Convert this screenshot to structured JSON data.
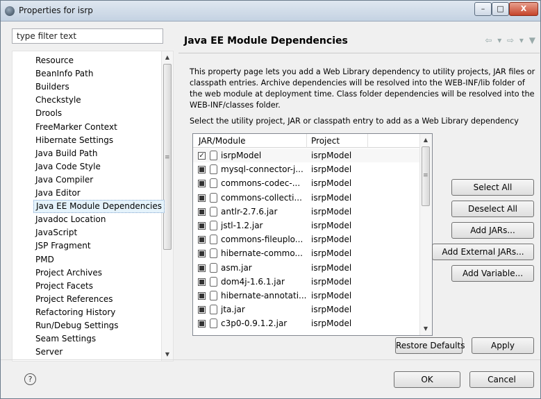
{
  "window": {
    "title": "Properties for isrp",
    "minimize_glyph": "–",
    "maximize_glyph": "□",
    "close_glyph": "X"
  },
  "filter": {
    "placeholder": "type filter text",
    "value": "type filter text"
  },
  "tree": {
    "items": [
      "Resource",
      "BeanInfo Path",
      "Builders",
      "Checkstyle",
      "Drools",
      "FreeMarker Context",
      "Hibernate Settings",
      "Java Build Path",
      "Java Code Style",
      "Java Compiler",
      "Java Editor",
      "Java EE Module Dependencies",
      "Javadoc Location",
      "JavaScript",
      "JSP Fragment",
      "PMD",
      "Project Archives",
      "Project Facets",
      "Project References",
      "Refactoring History",
      "Run/Debug Settings",
      "Seam Settings",
      "Server"
    ],
    "selected": "Java EE Module Dependencies"
  },
  "page": {
    "title": "Java EE Module Dependencies",
    "nav_glyphs": "⇦ ▾ ⇨ ▾ ▼",
    "description": "This property page lets you add a Web Library dependency to utility projects, JAR files or classpath entries. Archive dependencies will be resolved into the WEB-INF/lib folder of the web module at deployment time. Class folder dependencies will be resolved into the WEB-INF/classes folder.",
    "select_label": "Select the utility project, JAR or classpath entry to add as a Web Library dependency"
  },
  "table": {
    "headers": [
      "JAR/Module",
      "Project"
    ],
    "rows": [
      {
        "name": "isrpModel",
        "project": "isrpModel",
        "state": "checked"
      },
      {
        "name": "mysql-connector-j...",
        "project": "isrpModel",
        "state": "filled"
      },
      {
        "name": "commons-codec-...",
        "project": "isrpModel",
        "state": "filled"
      },
      {
        "name": "commons-collecti...",
        "project": "isrpModel",
        "state": "filled"
      },
      {
        "name": "antlr-2.7.6.jar",
        "project": "isrpModel",
        "state": "filled"
      },
      {
        "name": "jstl-1.2.jar",
        "project": "isrpModel",
        "state": "filled"
      },
      {
        "name": "commons-fileuplo...",
        "project": "isrpModel",
        "state": "filled"
      },
      {
        "name": "hibernate-commo...",
        "project": "isrpModel",
        "state": "filled"
      },
      {
        "name": "asm.jar",
        "project": "isrpModel",
        "state": "filled"
      },
      {
        "name": "dom4j-1.6.1.jar",
        "project": "isrpModel",
        "state": "filled"
      },
      {
        "name": "hibernate-annotati...",
        "project": "isrpModel",
        "state": "filled"
      },
      {
        "name": "jta.jar",
        "project": "isrpModel",
        "state": "filled"
      },
      {
        "name": "c3p0-0.9.1.2.jar",
        "project": "isrpModel",
        "state": "filled"
      }
    ]
  },
  "buttons": {
    "select_all": "Select All",
    "deselect_all": "Deselect All",
    "add_jars": "Add JARs...",
    "add_external_jars": "Add External JARs...",
    "add_variable": "Add Variable...",
    "restore_defaults": "Restore Defaults",
    "apply": "Apply",
    "ok": "OK",
    "cancel": "Cancel"
  },
  "help": {
    "glyph": "?"
  },
  "scroll": {
    "up": "▲",
    "down": "▼",
    "grip": "≡"
  }
}
